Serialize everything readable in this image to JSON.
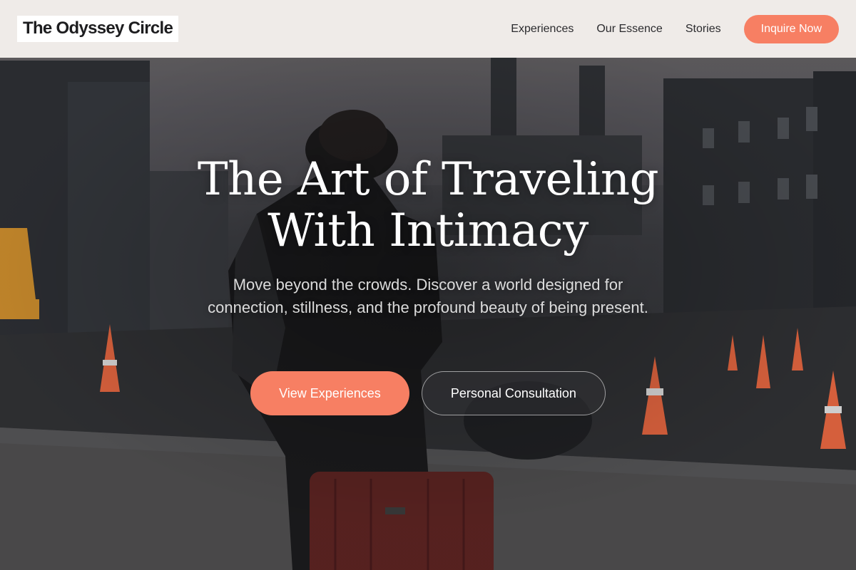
{
  "header": {
    "logo": "The Odyssey Circle",
    "nav": [
      "Experiences",
      "Our Essence",
      "Stories"
    ],
    "cta_label": "Inquire Now"
  },
  "hero": {
    "title_line1": "The Art of Traveling",
    "title_line2": "With Intimacy",
    "subtitle": "Move beyond the crowds. Discover a world designed for connection, stillness, and the profound beauty of being present.",
    "primary_button": "View Experiences",
    "secondary_button": "Personal Consultation"
  },
  "colors": {
    "accent": "#f77f63",
    "header_bg": "#f4f0ec",
    "text_dark": "#1d1d1f"
  }
}
